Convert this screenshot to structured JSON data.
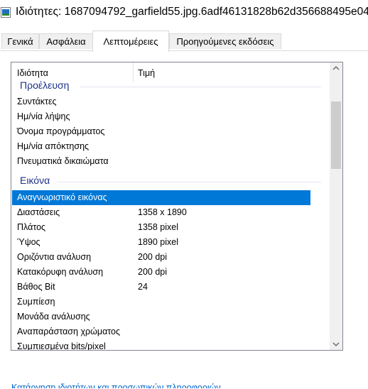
{
  "window": {
    "title": "Ιδιότητες: 1687094792_garfield55.jpg.6adf46131828b62d356688495e04..."
  },
  "tabs": [
    {
      "label": "Γενικά"
    },
    {
      "label": "Ασφάλεια"
    },
    {
      "label": "Λεπτομέρειες",
      "active": true
    },
    {
      "label": "Προηγούμενες εκδόσεις"
    }
  ],
  "details": {
    "header": {
      "name": "Ιδιότητα",
      "value": "Τιμή"
    },
    "groups": [
      {
        "label": "Προέλευση",
        "rows": [
          {
            "name": "Συντάκτες",
            "value": ""
          },
          {
            "name": "Ημ/νία λήψης",
            "value": ""
          },
          {
            "name": "Όνομα προγράμματος",
            "value": ""
          },
          {
            "name": "Ημ/νία απόκτησης",
            "value": ""
          },
          {
            "name": "Πνευματικά δικαιώματα",
            "value": ""
          }
        ]
      },
      {
        "label": "Εικόνα",
        "rows": [
          {
            "name": "Αναγνωριστικό εικόνας",
            "value": "",
            "selected": true
          },
          {
            "name": "Διαστάσεις",
            "value": "1358 x 1890"
          },
          {
            "name": "Πλάτος",
            "value": "1358 pixel"
          },
          {
            "name": "Ύψος",
            "value": "1890 pixel"
          },
          {
            "name": "Οριζόντια ανάλυση",
            "value": "200 dpi"
          },
          {
            "name": "Κατακόρυφη ανάλυση",
            "value": "200 dpi"
          },
          {
            "name": "Βάθος Bit",
            "value": "24"
          },
          {
            "name": "Συμπίεση",
            "value": ""
          },
          {
            "name": "Μονάδα ανάλυσης",
            "value": ""
          },
          {
            "name": "Αναπαράσταση χρώματος",
            "value": ""
          },
          {
            "name": "Συμπιεσμένα bits/pixel",
            "value": ""
          }
        ]
      }
    ]
  },
  "footer_link": {
    "text": "Κατάργηση ιδιοτήτων και προσωπικών πληροφοριών"
  },
  "colors": {
    "selection": "#0078d7",
    "group_label": "#1e3287",
    "link": "#0066cc"
  }
}
